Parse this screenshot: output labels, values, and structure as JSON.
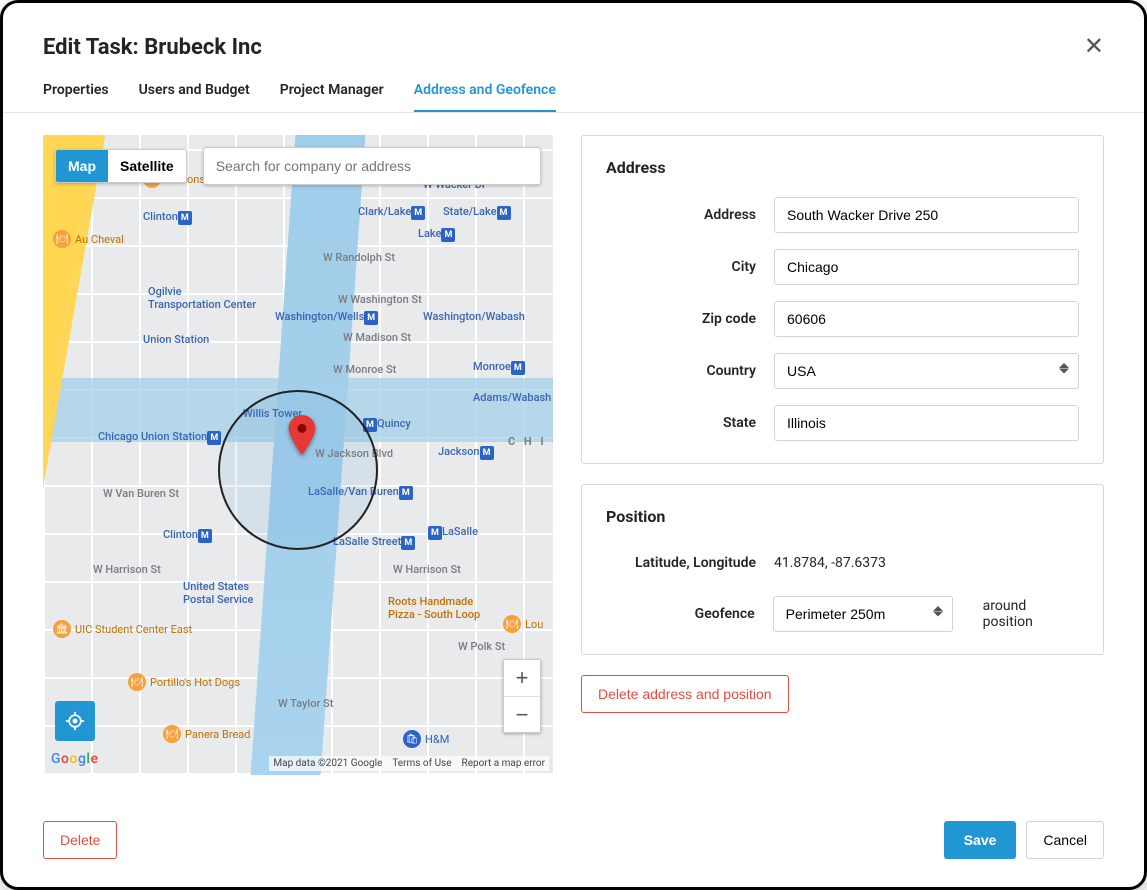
{
  "header": {
    "title": "Edit Task: Brubeck Inc"
  },
  "tabs": [
    {
      "label": "Properties",
      "active": false
    },
    {
      "label": "Users and Budget",
      "active": false
    },
    {
      "label": "Project Manager",
      "active": false
    },
    {
      "label": "Address and Geofence",
      "active": true
    }
  ],
  "map": {
    "type_map": "Map",
    "type_sat": "Satellite",
    "search_placeholder": "Search for company or address",
    "zoom_in": "+",
    "zoom_out": "−",
    "credit_data": "Map data ©2021 Google",
    "credit_terms": "Terms of Use",
    "credit_report": "Report a map error",
    "labels": {
      "clinton1": "Clinton",
      "clarklake": "Clark/Lake",
      "statelake": "State/Lake",
      "lake": "Lake",
      "randolph": "W Randolph St",
      "washington_st": "W Washington St",
      "ogilvie": "Ogilvie\nTransportation Center",
      "washington_wells": "Washington/Wells",
      "washington_wabash": "Washington/Wabash",
      "madison": "W Madison St",
      "union": "Union Station",
      "monroe_st": "W Monroe St",
      "monroe": "Monroe",
      "adams": "Adams/Wabash",
      "willis": "Willis Tower",
      "quincy": "Quincy",
      "jackson_blvd": "W Jackson Blvd",
      "jackson": "Jackson",
      "chic": "C H I C",
      "chicago_union": "Chicago Union Station",
      "lasalle_vb": "LaSalle/Van Buren",
      "vanburen": "W Van Buren St",
      "clinton2": "Clinton",
      "lasalle": "LaSalle",
      "lasalle_st": "LaSalle Street",
      "harrison": "W Harrison St",
      "harrison2": "W Harrison St",
      "usps": "United States\nPostal Service",
      "roots": "Roots Handmade\nPizza - South Loop",
      "polk": "W Polk St",
      "taylor": "W Taylor St",
      "wacker": "W Wacker Dr"
    },
    "poi": {
      "gibsons": "Gibsons Italia",
      "aucheval": "Au Cheval",
      "uic": "UIC Student Center East",
      "portillos": "Portillo's Hot Dogs",
      "panera": "Panera Bread",
      "hm": "H&M",
      "lou": "Lou"
    }
  },
  "address_card": {
    "heading": "Address",
    "address_label": "Address",
    "address_value": "South Wacker Drive 250",
    "city_label": "City",
    "city_value": "Chicago",
    "zip_label": "Zip code",
    "zip_value": "60606",
    "country_label": "Country",
    "country_value": "USA",
    "state_label": "State",
    "state_value": "Illinois"
  },
  "position_card": {
    "heading": "Position",
    "latlng_label": "Latitude, Longitude",
    "latlng_value": "41.8784, -87.6373",
    "geofence_label": "Geofence",
    "geofence_value": "Perimeter 250m",
    "around": "around position"
  },
  "actions": {
    "delete_address": "Delete address and position",
    "delete": "Delete",
    "save": "Save",
    "cancel": "Cancel"
  }
}
